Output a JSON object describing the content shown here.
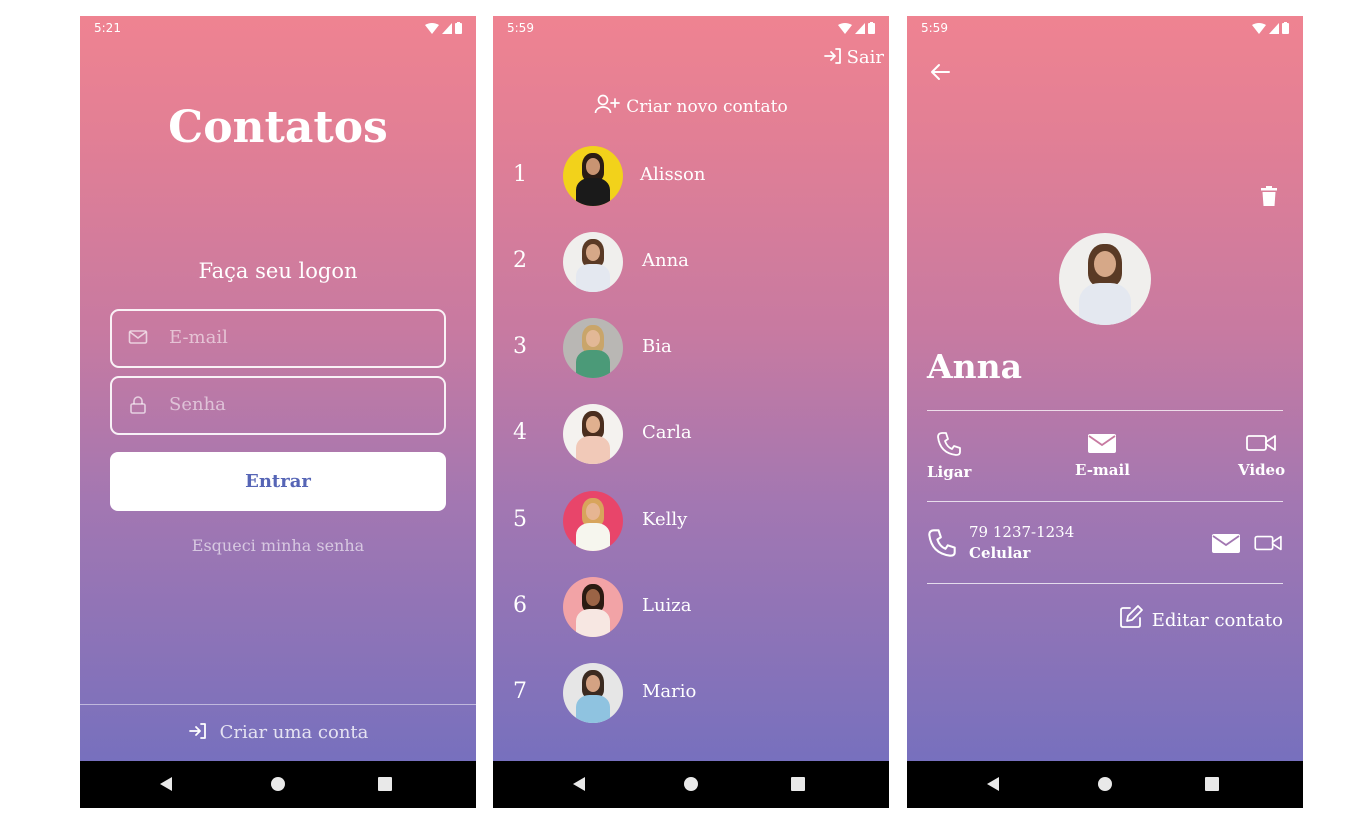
{
  "screens": {
    "login": {
      "time": "5:21",
      "title": "Contatos",
      "subtitle": "Faça seu logon",
      "email_placeholder": "E-mail",
      "password_placeholder": "Senha",
      "enter_label": "Entrar",
      "forgot_label": "Esqueci minha senha",
      "create_account_label": "Criar uma conta"
    },
    "list": {
      "time": "5:59",
      "logout_label": "Sair",
      "new_contact_label": "Criar novo contato",
      "contacts": [
        {
          "num": "1",
          "name": "Alisson"
        },
        {
          "num": "2",
          "name": "Anna"
        },
        {
          "num": "3",
          "name": "Bia"
        },
        {
          "num": "4",
          "name": "Carla"
        },
        {
          "num": "5",
          "name": "Kelly"
        },
        {
          "num": "6",
          "name": "Luiza"
        },
        {
          "num": "7",
          "name": "Mario"
        }
      ]
    },
    "detail": {
      "time": "5:59",
      "name": "Anna",
      "actions": {
        "call": "Ligar",
        "email": "E-mail",
        "video": "Video"
      },
      "phone_number": "79 1237-1234",
      "phone_type": "Celular",
      "edit_label": "Editar contato"
    }
  },
  "colors": {
    "gradient_top": "#ef8391",
    "gradient_bottom": "#6f6fc0",
    "button_text": "#5665b6",
    "nav_bar": "#000000"
  }
}
